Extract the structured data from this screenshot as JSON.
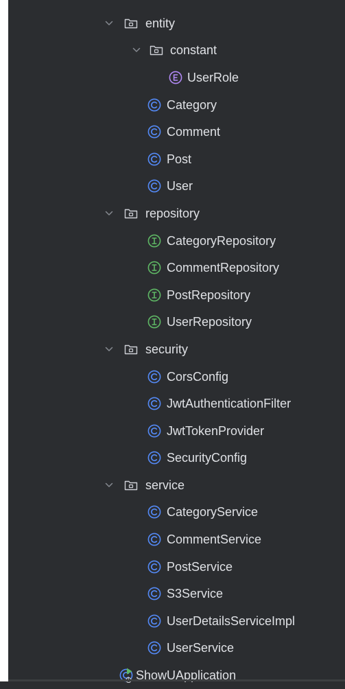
{
  "project_tree": {
    "items": [
      {
        "name": "entity",
        "kind": "package",
        "depth": 0,
        "expanded": true
      },
      {
        "name": "constant",
        "kind": "package",
        "depth": 1,
        "expanded": true
      },
      {
        "name": "UserRole",
        "kind": "enum",
        "depth": 2
      },
      {
        "name": "Category",
        "kind": "class",
        "depth": 1
      },
      {
        "name": "Comment",
        "kind": "class",
        "depth": 1
      },
      {
        "name": "Post",
        "kind": "class",
        "depth": 1
      },
      {
        "name": "User",
        "kind": "class",
        "depth": 1
      },
      {
        "name": "repository",
        "kind": "package",
        "depth": 0,
        "expanded": true
      },
      {
        "name": "CategoryRepository",
        "kind": "interface",
        "depth": 1
      },
      {
        "name": "CommentRepository",
        "kind": "interface",
        "depth": 1
      },
      {
        "name": "PostRepository",
        "kind": "interface",
        "depth": 1
      },
      {
        "name": "UserRepository",
        "kind": "interface",
        "depth": 1
      },
      {
        "name": "security",
        "kind": "package",
        "depth": 0,
        "expanded": true
      },
      {
        "name": "CorsConfig",
        "kind": "class",
        "depth": 1
      },
      {
        "name": "JwtAuthenticationFilter",
        "kind": "class",
        "depth": 1
      },
      {
        "name": "JwtTokenProvider",
        "kind": "class",
        "depth": 1
      },
      {
        "name": "SecurityConfig",
        "kind": "class",
        "depth": 1
      },
      {
        "name": "service",
        "kind": "package",
        "depth": 0,
        "expanded": true
      },
      {
        "name": "CategoryService",
        "kind": "class",
        "depth": 1
      },
      {
        "name": "CommentService",
        "kind": "class",
        "depth": 1
      },
      {
        "name": "PostService",
        "kind": "class",
        "depth": 1
      },
      {
        "name": "S3Service",
        "kind": "class",
        "depth": 1
      },
      {
        "name": "UserDetailsServiceImpl",
        "kind": "class",
        "depth": 1
      },
      {
        "name": "UserService",
        "kind": "class",
        "depth": 1
      },
      {
        "name": "ShowUApplication",
        "kind": "spring-app",
        "depth": 0
      }
    ]
  },
  "colors": {
    "background": "#2b2d30",
    "text": "#dfe1e5",
    "chevron": "#868a91",
    "folder": "#ced0d6",
    "class_badge": "#548af7",
    "enum_badge": "#b189f5",
    "interface_badge": "#5fb865",
    "spring_badge": "#5fb865"
  },
  "icons": {
    "chevron": "chevron-down-icon",
    "package": "package-folder-icon",
    "class": "class-icon",
    "enum": "enum-icon",
    "interface": "interface-icon",
    "spring-app": "spring-boot-app-icon"
  },
  "badge_letters": {
    "class": "C",
    "enum": "E",
    "interface": "I",
    "spring-app": "C"
  }
}
